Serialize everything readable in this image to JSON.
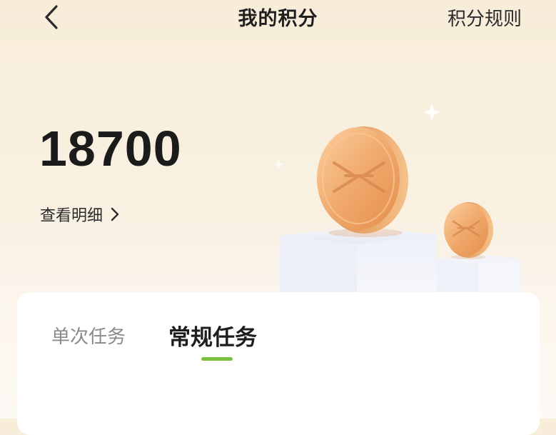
{
  "header": {
    "title": "我的积分",
    "rules_label": "积分规则"
  },
  "points": {
    "value": "18700",
    "detail_label": "查看明细"
  },
  "tabs": [
    {
      "label": "单次任务",
      "active": false
    },
    {
      "label": "常规任务",
      "active": true
    }
  ],
  "colors": {
    "accent": "#7cc13d",
    "coin": "#f2b27a",
    "background": "#f8efde"
  },
  "icons": {
    "back": "chevron-left-icon",
    "detail": "chevron-right-icon",
    "coin": "coin-icon"
  }
}
